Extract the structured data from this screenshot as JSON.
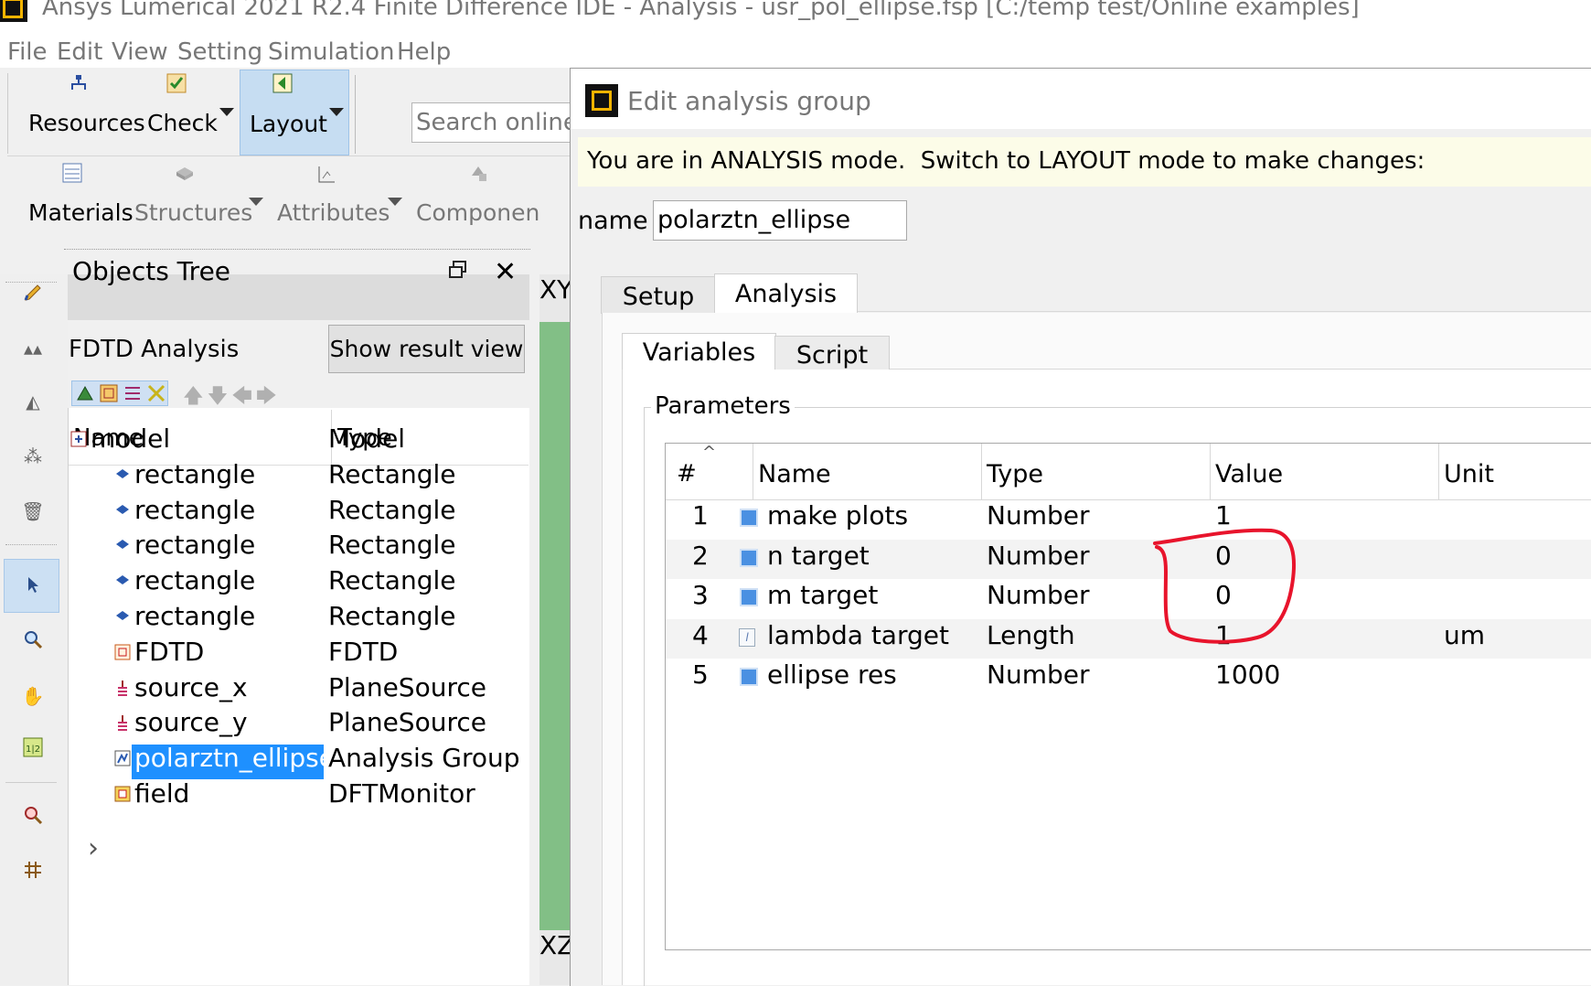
{
  "window": {
    "title": "Ansys Lumerical 2021 R2.4 Finite Difference IDE - Analysis - usr_pol_ellipse.fsp [C:/temp test/Online examples]"
  },
  "menubar": {
    "items": [
      "File",
      "Edit",
      "View",
      "Setting",
      "Simulation",
      "Help"
    ]
  },
  "toolbar": {
    "resources": "Resources",
    "check": "Check",
    "layout": "Layout",
    "search_placeholder": "Search online",
    "materials": "Materials",
    "structures": "Structures",
    "attributes": "Attributes",
    "components": "Componen"
  },
  "objects_tree": {
    "title": "Objects Tree",
    "mode": "FDTD Analysis",
    "show_result_button": "Show result view",
    "columns": [
      "Name",
      "Type"
    ],
    "rows": [
      {
        "name": "model",
        "type": "Model",
        "icon": "model-icon"
      },
      {
        "name": "rectangle",
        "type": "Rectangle",
        "icon": "rectangle-icon"
      },
      {
        "name": "rectangle",
        "type": "Rectangle",
        "icon": "rectangle-icon"
      },
      {
        "name": "rectangle",
        "type": "Rectangle",
        "icon": "rectangle-icon"
      },
      {
        "name": "rectangle",
        "type": "Rectangle",
        "icon": "rectangle-icon"
      },
      {
        "name": "rectangle",
        "type": "Rectangle",
        "icon": "rectangle-icon"
      },
      {
        "name": "FDTD",
        "type": "FDTD",
        "icon": "fdtd-icon"
      },
      {
        "name": "source_x",
        "type": "PlaneSource",
        "icon": "source-icon"
      },
      {
        "name": "source_y",
        "type": "PlaneSource",
        "icon": "source-icon"
      },
      {
        "name": "polarztn_ellipse",
        "type": "Analysis Group",
        "icon": "analysis-group-icon",
        "selected": true
      },
      {
        "name": "field",
        "type": "DFTMonitor",
        "icon": "monitor-icon"
      }
    ]
  },
  "view_tabs": {
    "xy": "XY",
    "xz": "XZ"
  },
  "dialog": {
    "title": "Edit analysis group",
    "banner": "You are in ANALYSIS mode.  Switch to LAYOUT mode to make changes:",
    "name_label": "name",
    "name_value": "polarztn_ellipse",
    "tabs": [
      "Setup",
      "Analysis"
    ],
    "active_tab": "Analysis",
    "subtabs": [
      "Variables",
      "Script"
    ],
    "active_subtab": "Variables",
    "group_label": "Parameters",
    "table": {
      "columns": [
        "#",
        "Name",
        "Type",
        "Value",
        "Unit"
      ],
      "rows": [
        {
          "num": "1",
          "name": "make plots",
          "type": "Number",
          "value": "1",
          "unit": ""
        },
        {
          "num": "2",
          "name": "n target",
          "type": "Number",
          "value": "0",
          "unit": ""
        },
        {
          "num": "3",
          "name": "m target",
          "type": "Number",
          "value": "0",
          "unit": ""
        },
        {
          "num": "4",
          "name": "lambda target",
          "type": "Length",
          "value": "1",
          "unit": "um"
        },
        {
          "num": "5",
          "name": "ellipse res",
          "type": "Number",
          "value": "1000",
          "unit": ""
        }
      ]
    }
  },
  "colors": {
    "selection": "#1e90ff",
    "annotation": "#e8142c",
    "banner_bg": "#fcfce8",
    "accent_green": "#82bf86"
  }
}
